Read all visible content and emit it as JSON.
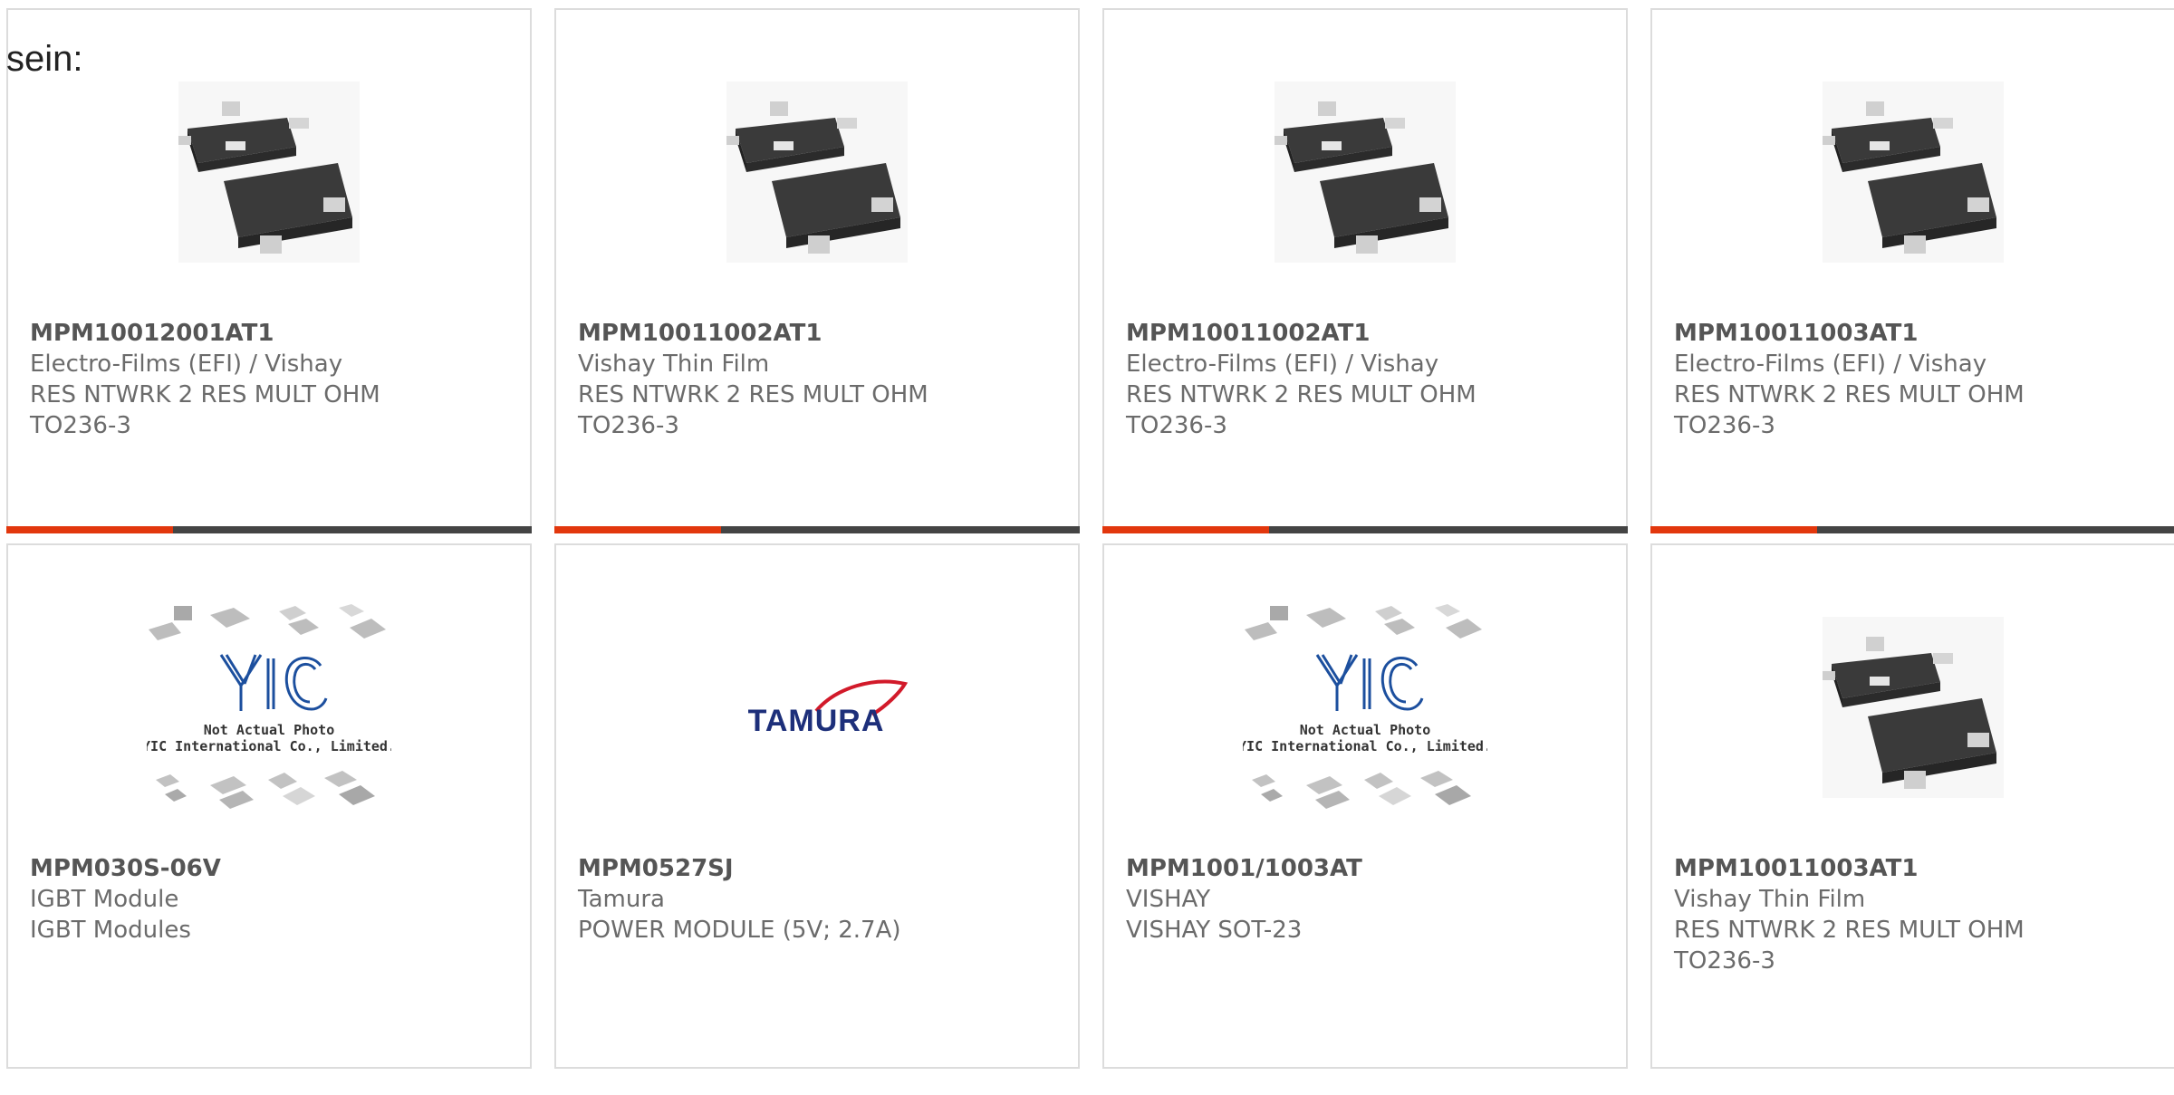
{
  "intro_text": "sein:",
  "colors": {
    "accent": "#e2370d",
    "bar": "#444444",
    "border": "#dcdcdc",
    "text": "#6b6b6b"
  },
  "products": [
    {
      "part_number": "MPM10012001AT1",
      "manufacturer": "Electro-Films (EFI) / Vishay",
      "description": "RES NTWRK 2 RES MULT OHM",
      "package": "TO236-3",
      "image": "sot23-package-photo",
      "highlighted": true
    },
    {
      "part_number": "MPM10011002AT1",
      "manufacturer": "Vishay Thin Film",
      "description": "RES NTWRK 2 RES MULT OHM",
      "package": "TO236-3",
      "image": "sot23-package-photo",
      "highlighted": true
    },
    {
      "part_number": "MPM10011002AT1",
      "manufacturer": "Electro-Films (EFI) / Vishay",
      "description": "RES NTWRK 2 RES MULT OHM",
      "package": "TO236-3",
      "image": "sot23-package-photo",
      "highlighted": true
    },
    {
      "part_number": "MPM10011003AT1",
      "manufacturer": "Electro-Films (EFI) / Vishay",
      "description": "RES NTWRK 2 RES MULT OHM",
      "package": "TO236-3",
      "image": "sot23-package-photo",
      "highlighted": true
    },
    {
      "part_number": "MPM030S-06V",
      "manufacturer": "IGBT Module",
      "description": "IGBT Modules",
      "package": "",
      "image": "yic-placeholder",
      "highlighted": false
    },
    {
      "part_number": "MPM0527SJ",
      "manufacturer": "Tamura",
      "description": "POWER MODULE (5V; 2.7A)",
      "package": "",
      "image": "tamura-logo",
      "highlighted": false
    },
    {
      "part_number": "MPM1001/1003AT",
      "manufacturer": "VISHAY",
      "description": "VISHAY SOT-23",
      "package": "",
      "image": "yic-placeholder",
      "highlighted": false
    },
    {
      "part_number": "MPM10011003AT1",
      "manufacturer": "Vishay Thin Film",
      "description": "RES NTWRK 2 RES MULT OHM",
      "package": "TO236-3",
      "image": "sot23-package-photo",
      "highlighted": false
    }
  ],
  "placeholder_image": {
    "logo_text": "YIC",
    "caption_line1": "Not Actual Photo",
    "caption_line2": "YIC International Co., Limited."
  },
  "tamura_logo_text": "TAMURA"
}
